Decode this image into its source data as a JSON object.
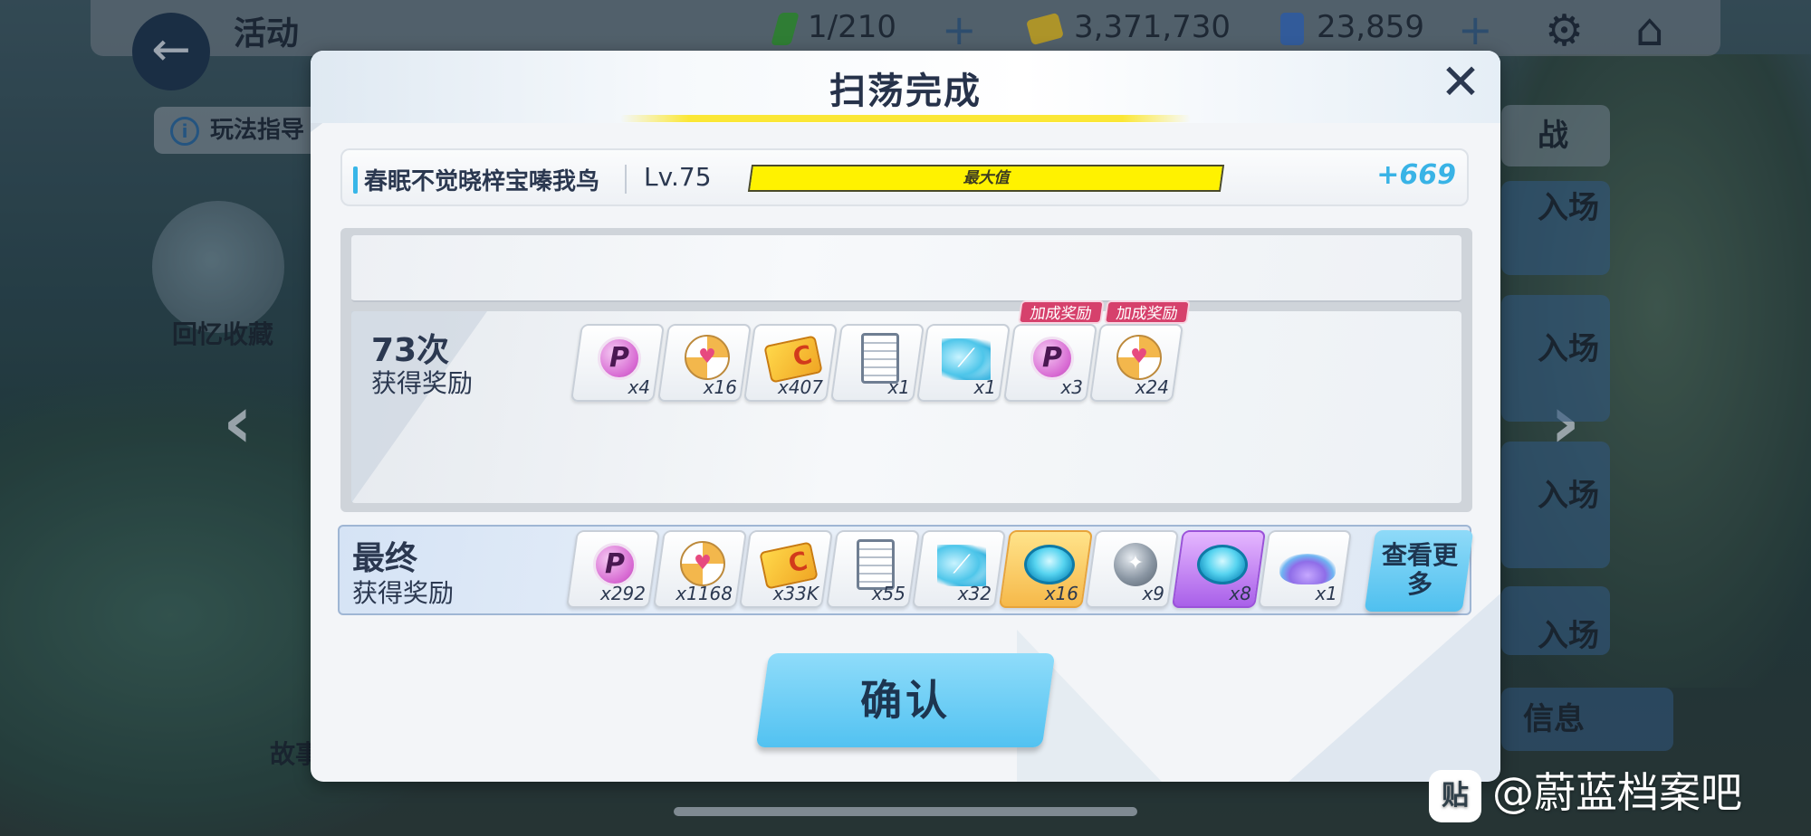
{
  "background": {
    "title": "活动",
    "resources": [
      {
        "name": "ap",
        "value": "1/210",
        "color": "#3aa23a"
      },
      {
        "name": "credits",
        "value": "3,371,730",
        "color": "#e8c22a"
      },
      {
        "name": "pyroxene",
        "value": "23,859",
        "color": "#3d74c7"
      }
    ],
    "guide_label": "玩法指导",
    "memory_label": "回忆收藏",
    "story_label": "故事",
    "right_panel": [
      "战",
      "入场",
      "入场",
      "入场",
      "入场"
    ],
    "info_label": "信息"
  },
  "dialog": {
    "title": "扫荡完成",
    "exp": {
      "name": "春眠不觉晓梓宝嗪我鸟",
      "level": "Lv.75",
      "progress_fraction": 1.0,
      "max_label": "最大值",
      "gain": "+669"
    },
    "sweep": {
      "count": "73次",
      "caption": "获得奖励",
      "items": [
        {
          "icon": "p-coin-icon",
          "qty": "x4",
          "bonus": ""
        },
        {
          "icon": "beach-ball-icon",
          "qty": "x16",
          "bonus": ""
        },
        {
          "icon": "credit-card-icon",
          "qty": "x407",
          "bonus": ""
        },
        {
          "icon": "report-icon",
          "qty": "x1",
          "bonus": ""
        },
        {
          "icon": "crystal-shard-icon",
          "qty": "x1",
          "bonus": ""
        },
        {
          "icon": "p-coin-icon",
          "qty": "x3",
          "bonus": "加成奖励"
        },
        {
          "icon": "beach-ball-icon",
          "qty": "x24",
          "bonus": "加成奖励"
        }
      ]
    },
    "final": {
      "title": "最终",
      "caption": "获得奖励",
      "items": [
        {
          "icon": "p-coin-icon",
          "qty": "x292",
          "tier": "normal"
        },
        {
          "icon": "beach-ball-icon",
          "qty": "x1168",
          "tier": "normal"
        },
        {
          "icon": "credit-card-icon",
          "qty": "x33K",
          "tier": "normal"
        },
        {
          "icon": "report-icon",
          "qty": "x55",
          "tier": "normal"
        },
        {
          "icon": "crystal-shard-icon",
          "qty": "x32",
          "tier": "normal"
        },
        {
          "icon": "blue-bowl-icon",
          "qty": "x16",
          "tier": "gold"
        },
        {
          "icon": "grey-orb-icon",
          "qty": "x9",
          "tier": "normal"
        },
        {
          "icon": "blue-bowl-icon",
          "qty": "x8",
          "tier": "purple"
        },
        {
          "icon": "crystal-dust-icon",
          "qty": "x1",
          "tier": "normal"
        }
      ],
      "more_label": "查看更多"
    },
    "confirm_label": "确认"
  },
  "watermark": {
    "logo": "贴",
    "text": "@蔚蓝档案吧"
  }
}
